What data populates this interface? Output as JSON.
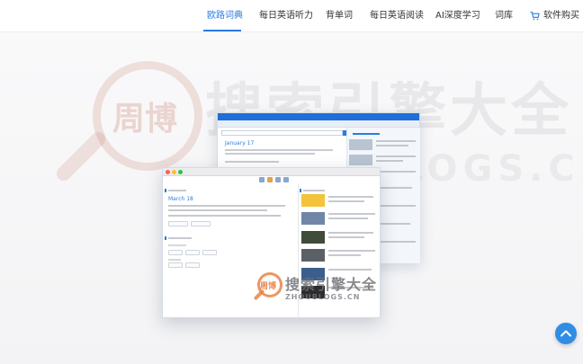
{
  "nav": {
    "items": [
      "欧路词典",
      "每日英语听力",
      "背单词",
      "每日英语阅读",
      "AI深度学习",
      "词库"
    ],
    "active_index": 0,
    "cart": {
      "label": "软件购买",
      "icon": "cart-icon"
    }
  },
  "watermark": {
    "logo_text": "周博",
    "main_text": "搜索引擎大全",
    "sub_text": "ZHOUBLOGS.CN"
  },
  "screenshot": {
    "back_date": "January 17",
    "front_date": "March 18"
  },
  "colors": {
    "accent": "#2a7be4",
    "watermark": "#eb8246",
    "scroll_top": "#2f8de4"
  },
  "scroll_top": {
    "icon": "chevron-up-icon"
  }
}
